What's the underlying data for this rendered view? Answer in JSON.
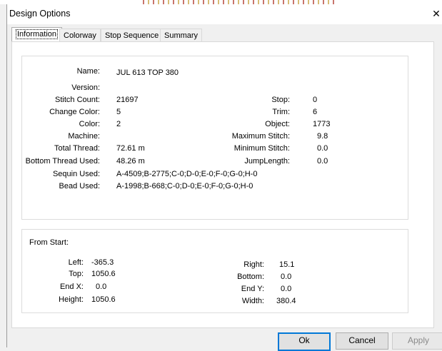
{
  "window": {
    "title": "Design Options",
    "close_glyph": "✕"
  },
  "tabs": [
    {
      "label": "Information",
      "active": true
    },
    {
      "label": "Colorway",
      "active": false
    },
    {
      "label": "Stop Sequence",
      "active": false
    },
    {
      "label": "Summary",
      "active": false
    }
  ],
  "info": {
    "name": {
      "label": "Name:",
      "value": "JUL 613 TOP 380"
    },
    "version": {
      "label": "Version:",
      "value": ""
    },
    "stitch_count": {
      "label": "Stitch Count:",
      "value": "21697"
    },
    "change_color": {
      "label": "Change Color:",
      "value": "5"
    },
    "color": {
      "label": "Color:",
      "value": "2"
    },
    "machine": {
      "label": "Machine:",
      "value": ""
    },
    "total_thread": {
      "label": "Total Thread:",
      "value": "72.61 m"
    },
    "bottom_thread": {
      "label": "Bottom Thread Used:",
      "value": "48.26 m"
    },
    "sequin_used": {
      "label": "Sequin Used:",
      "value": "A-4509;B-2775;C-0;D-0;E-0;F-0;G-0;H-0"
    },
    "bead_used": {
      "label": "Bead Used:",
      "value": "A-1998;B-668;C-0;D-0;E-0;F-0;G-0;H-0"
    },
    "stop": {
      "label": "Stop:",
      "value": "0"
    },
    "trim": {
      "label": "Trim:",
      "value": "6"
    },
    "object": {
      "label": "Object:",
      "value": "1773"
    },
    "max_stitch": {
      "label": "Maximum Stitch:",
      "value": "9.8"
    },
    "min_stitch": {
      "label": "Minimum Stitch:",
      "value": "0.0"
    },
    "jump_length": {
      "label": "JumpLength:",
      "value": "0.0"
    }
  },
  "from_start": {
    "heading": "From Start:",
    "left": {
      "label": "Left:",
      "value": "-365.3"
    },
    "top": {
      "label": "Top:",
      "value": "1050.6"
    },
    "end_x": {
      "label": "End X:",
      "value": "0.0"
    },
    "height": {
      "label": "Height:",
      "value": "1050.6"
    },
    "right": {
      "label": "Right:",
      "value": "15.1"
    },
    "bottom": {
      "label": "Bottom:",
      "value": "0.0"
    },
    "end_y": {
      "label": "End Y:",
      "value": "0.0"
    },
    "width": {
      "label": "Width:",
      "value": "380.4"
    }
  },
  "buttons": {
    "ok": "Ok",
    "cancel": "Cancel",
    "apply": "Apply"
  }
}
